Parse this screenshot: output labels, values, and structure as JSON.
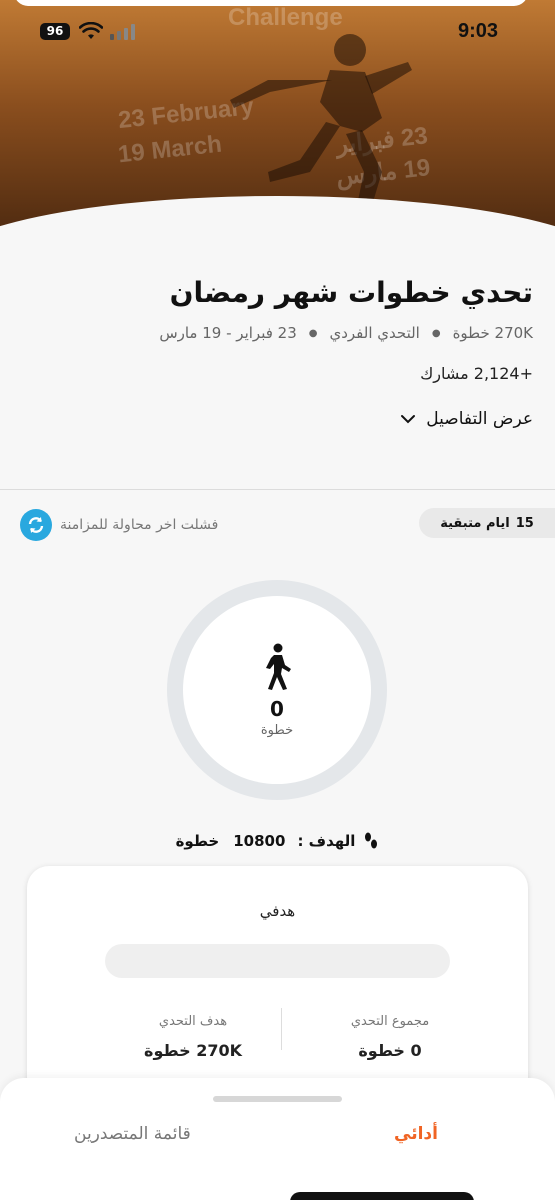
{
  "status_bar": {
    "battery": "96",
    "time": "9:03"
  },
  "hero": {
    "top_word": "Challenge",
    "date_en_1": "23 February",
    "date_en_2": "19 March",
    "date_ar_1": "23 فبراير",
    "date_ar_2": "19 مارس"
  },
  "challenge": {
    "title": "تحدي خطوات شهر رمضان",
    "meta": [
      "270K خطوة",
      "التحدي الفردي",
      "23 فبراير - 19 مارس"
    ],
    "participants": "+2,124 مشارك",
    "details_label": "عرض التفاصيل"
  },
  "sync": {
    "message": "فشلت اخر محاولة للمزامنة"
  },
  "days_left": {
    "count": "15",
    "label": "ايام متبقية"
  },
  "ring": {
    "steps": "0",
    "unit": "خطوة",
    "progress": 0
  },
  "goal": {
    "label": "الهدف :",
    "value": "10800",
    "unit": "خطوة"
  },
  "card": {
    "title": "هدفي",
    "progress": 0,
    "total_label": "مجموع التحدي",
    "total_value": "0 خطوة",
    "target_label": "هدف التحدي",
    "target_value": "270K خطوة"
  },
  "tabs": {
    "mine": "أدائي",
    "leaders": "قائمة المتصدرين"
  },
  "colors": {
    "accent": "#f06424",
    "sync_blue": "#29a8df"
  }
}
